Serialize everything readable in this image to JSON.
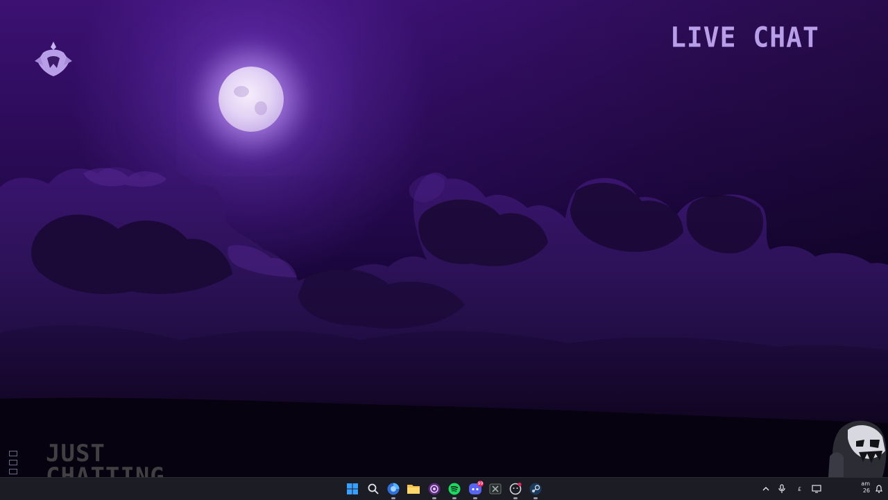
{
  "overlay": {
    "live_chat_label": "LIVE CHAT",
    "category_line1": "JUST",
    "category_line2": "CHATTING"
  },
  "colors": {
    "sky_top": "#3c1173",
    "sky_bottom": "#07020f",
    "moon": "#ecdcf8",
    "accent_text": "#b89ee8",
    "taskbar": "#1c1c24"
  },
  "taskbar": {
    "apps": [
      {
        "name": "start-button",
        "icon": "windows-logo-icon"
      },
      {
        "name": "search-button",
        "icon": "search-icon"
      },
      {
        "name": "browser-app",
        "icon": "browser-icon"
      },
      {
        "name": "file-explorer-app",
        "icon": "folder-icon"
      },
      {
        "name": "obs-app",
        "icon": "record-icon"
      },
      {
        "name": "spotify-app",
        "icon": "spotify-icon"
      },
      {
        "name": "discord-app",
        "icon": "discord-icon",
        "badge": "99"
      },
      {
        "name": "excel-app",
        "icon": "spreadsheet-icon"
      },
      {
        "name": "chat-app",
        "icon": "chat-icon"
      },
      {
        "name": "steam-app",
        "icon": "steam-icon"
      }
    ],
    "tray": {
      "currency_symbol": "£",
      "clock_ampm": "am",
      "clock_day": "26"
    }
  }
}
